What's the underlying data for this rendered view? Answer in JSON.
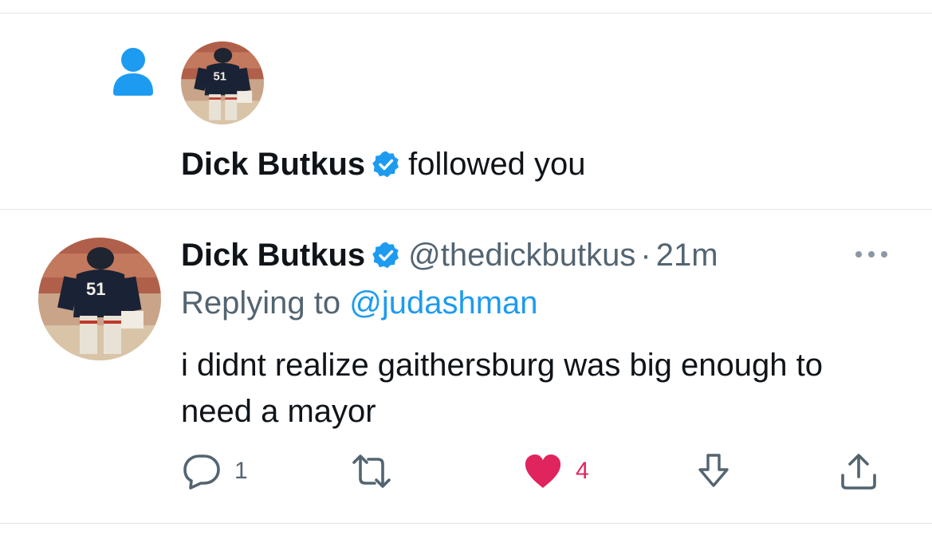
{
  "follow_notification": {
    "icon": "person-icon",
    "user_name": "Dick Butkus",
    "action_text": "followed you",
    "avatar_jersey": "51"
  },
  "tweet": {
    "author_name": "Dick Butkus",
    "handle": "@thedickbutkus",
    "separator": "·",
    "time": "21m",
    "replying_prefix": "Replying to",
    "replying_handle": "@judashman",
    "text": "i didnt realize gaithersburg was big enough to need a mayor",
    "avatar_jersey": "51",
    "actions": {
      "reply_count": "1",
      "retweet_count": "",
      "like_count": "4",
      "liked": true
    }
  },
  "colors": {
    "accent": "#1d9bf0",
    "like": "#e0245e",
    "muted": "#536471",
    "text": "#0f1419",
    "divider": "#e1e6ea"
  }
}
